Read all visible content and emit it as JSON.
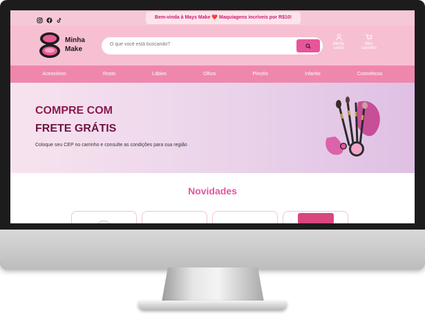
{
  "topbar": {
    "promo": "Bem-vinda à Mays Make ❤️ Maquiagens incríveis por R$10!",
    "social_icons": [
      "instagram-icon",
      "facebook-icon",
      "tiktok-icon"
    ]
  },
  "header": {
    "logo_line1": "Minha",
    "logo_line2": "Make",
    "search_placeholder": "O que você está buscando?",
    "account_line1": "Minha",
    "account_line2": "conta",
    "cart_line1": "Meu",
    "cart_line2": "carrinho"
  },
  "nav": {
    "items": [
      "Acessórios",
      "Rosto",
      "Lábios",
      "Olhos",
      "Pincéis",
      "Infantis",
      "Cosméticos"
    ]
  },
  "hero": {
    "title_line1": "COMPRE COM",
    "title_line2": "FRETE GRÁTIS",
    "subtitle": "Coloque seu CEP no carrinho e consulte as condições para sua região"
  },
  "novidades": {
    "title": "Novidades"
  },
  "colors": {
    "topbar": "#f6c8d7",
    "header": "#f7bfd2",
    "nav": "#ef87ad",
    "accent": "#e8559a",
    "hero_title": "#8a1a4e"
  }
}
